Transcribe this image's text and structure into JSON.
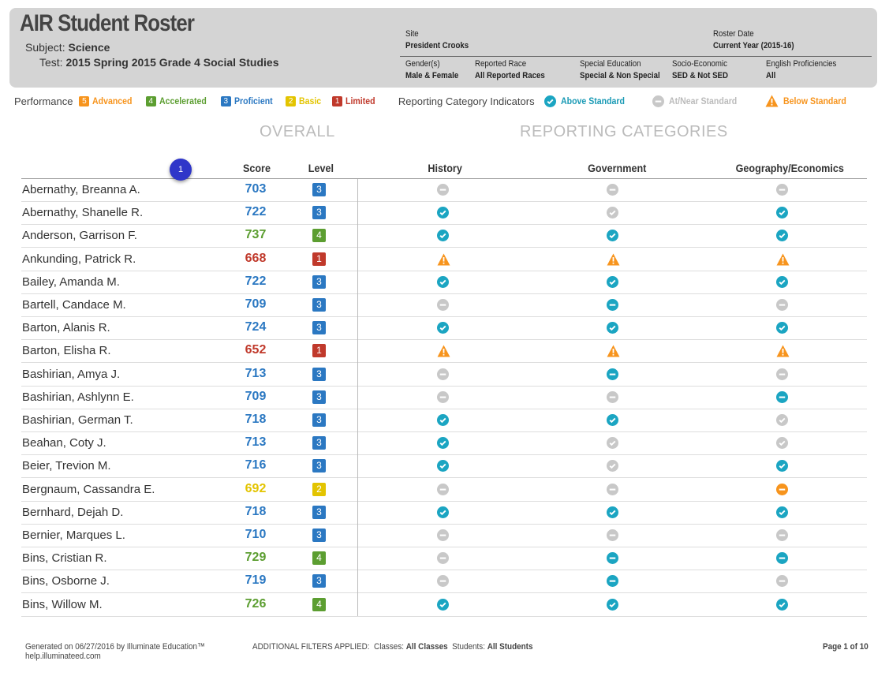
{
  "header": {
    "title": "AIR Student Roster",
    "subject_label": "Subject:",
    "subject_value": "Science",
    "test_label": "Test:",
    "test_value": "2015 Spring 2015 Grade 4 Social Studies",
    "site_label": "Site",
    "site_value": "President Crooks",
    "roster_date_label": "Roster Date",
    "roster_date_value": "Current Year (2015-16)",
    "gender_label": "Gender(s)",
    "gender_value": "Male & Female",
    "race_label": "Reported Race",
    "race_value": "All Reported Races",
    "sped_label": "Special Education",
    "sped_value": "Special & Non Special",
    "ses_label": "Socio-Economic",
    "ses_value": "SED & Not SED",
    "ell_label": "English Proficiencies",
    "ell_value": "All"
  },
  "legend": {
    "performance_label": "Performance",
    "levels": [
      {
        "num": "5",
        "label": "Advanced",
        "color": "#f7941d"
      },
      {
        "num": "4",
        "label": "Accelerated",
        "color": "#5c9e31"
      },
      {
        "num": "3",
        "label": "Proficient",
        "color": "#2b78c2"
      },
      {
        "num": "2",
        "label": "Basic",
        "color": "#e3c400"
      },
      {
        "num": "1",
        "label": "Limited",
        "color": "#c0392b"
      }
    ],
    "indicators_label": "Reporting Category Indicators",
    "indicators": [
      {
        "label": "Above Standard",
        "color": "#1ba5c2",
        "icon": "check-circle-icon"
      },
      {
        "label": "At/Near Standard",
        "color": "#bbbbbb",
        "icon": "minus-circle-icon"
      },
      {
        "label": "Below Standard",
        "color": "#f7941d",
        "icon": "warning-triangle-icon"
      }
    ]
  },
  "sections": {
    "overall": "OVERALL",
    "reporting": "REPORTING CATEGORIES"
  },
  "columns": {
    "score": "Score",
    "level": "Level",
    "history": "History",
    "government": "Government",
    "geography": "Geography/Economics"
  },
  "annotation_marker": "1",
  "students": [
    {
      "name": "Abernathy, Breanna A.",
      "score": "703",
      "level": "3",
      "history": "near",
      "government": "near",
      "geography": "near"
    },
    {
      "name": "Abernathy, Shanelle R.",
      "score": "722",
      "level": "3",
      "history": "above",
      "government": "near-check",
      "geography": "above"
    },
    {
      "name": "Anderson, Garrison F.",
      "score": "737",
      "level": "4",
      "history": "above",
      "government": "above",
      "geography": "above"
    },
    {
      "name": "Ankunding, Patrick R.",
      "score": "668",
      "level": "1",
      "history": "below",
      "government": "below",
      "geography": "below"
    },
    {
      "name": "Bailey, Amanda M.",
      "score": "722",
      "level": "3",
      "history": "above",
      "government": "above",
      "geography": "above"
    },
    {
      "name": "Bartell, Candace M.",
      "score": "709",
      "level": "3",
      "history": "near",
      "government": "near-blue",
      "geography": "near"
    },
    {
      "name": "Barton, Alanis R.",
      "score": "724",
      "level": "3",
      "history": "above",
      "government": "above",
      "geography": "above"
    },
    {
      "name": "Barton, Elisha R.",
      "score": "652",
      "level": "1",
      "history": "below",
      "government": "below",
      "geography": "below"
    },
    {
      "name": "Bashirian, Amya J.",
      "score": "713",
      "level": "3",
      "history": "near",
      "government": "near-blue",
      "geography": "near"
    },
    {
      "name": "Bashirian, Ashlynn E.",
      "score": "709",
      "level": "3",
      "history": "near",
      "government": "near",
      "geography": "near-blue"
    },
    {
      "name": "Bashirian, German T.",
      "score": "718",
      "level": "3",
      "history": "above",
      "government": "above",
      "geography": "near-check"
    },
    {
      "name": "Beahan, Coty J.",
      "score": "713",
      "level": "3",
      "history": "above",
      "government": "near-check",
      "geography": "near-check"
    },
    {
      "name": "Beier, Trevion M.",
      "score": "716",
      "level": "3",
      "history": "above",
      "government": "near-check",
      "geography": "above"
    },
    {
      "name": "Bergnaum, Cassandra E.",
      "score": "692",
      "level": "2",
      "history": "near",
      "government": "near",
      "geography": "near-orange"
    },
    {
      "name": "Bernhard, Dejah D.",
      "score": "718",
      "level": "3",
      "history": "above",
      "government": "above",
      "geography": "above"
    },
    {
      "name": "Bernier, Marques L.",
      "score": "710",
      "level": "3",
      "history": "near",
      "government": "near",
      "geography": "near"
    },
    {
      "name": "Bins, Cristian R.",
      "score": "729",
      "level": "4",
      "history": "near",
      "government": "near-blue",
      "geography": "near-blue"
    },
    {
      "name": "Bins, Osborne J.",
      "score": "719",
      "level": "3",
      "history": "near",
      "government": "near-blue",
      "geography": "near"
    },
    {
      "name": "Bins, Willow M.",
      "score": "726",
      "level": "4",
      "history": "above",
      "government": "above",
      "geography": "above"
    }
  ],
  "footer": {
    "generated": "Generated on 06/27/2016 by Illuminate Education™",
    "help": "help.illuminateed.com",
    "filters_label": "ADDITIONAL FILTERS APPLIED:",
    "classes_label": "Classes:",
    "classes_value": "All Classes",
    "students_label": "Students:",
    "students_value": "All Students",
    "page": "Page 1 of 10"
  }
}
